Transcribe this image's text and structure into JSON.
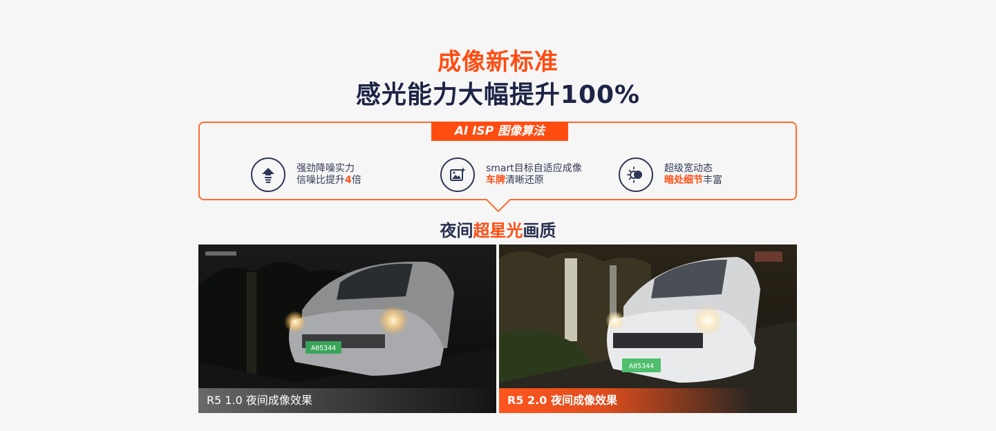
{
  "header": {
    "title_line1": "成像新标准",
    "title_line2": "感光能力大幅提升100%"
  },
  "feature_box": {
    "tab_label": "AI ISP 图像算法",
    "features": [
      {
        "icon": "noise-reduction-arrow-icon",
        "line1": "强劲降噪实力",
        "line2_prefix": "信噪比提升",
        "line2_highlight": "4",
        "line2_suffix": "倍"
      },
      {
        "icon": "image-sparkle-icon",
        "line1": "smart目标自适应成像",
        "line2_highlight": "车牌",
        "line2_suffix": "清晰还原"
      },
      {
        "icon": "wide-dynamic-range-icon",
        "line1": "超级宽动态",
        "line2_highlight": "暗处细节",
        "line2_suffix": "丰富"
      }
    ]
  },
  "subheading": {
    "prefix": "夜间",
    "highlight": "超星光",
    "suffix": "画质"
  },
  "photos": {
    "left_caption": "R5 1.0 夜间成像效果",
    "right_caption": "R5 2.0 夜间成像效果",
    "plate_text": "A05344"
  },
  "colors": {
    "accent": "#ff4d12",
    "navy": "#1d2446",
    "background": "#f6f6f6"
  }
}
